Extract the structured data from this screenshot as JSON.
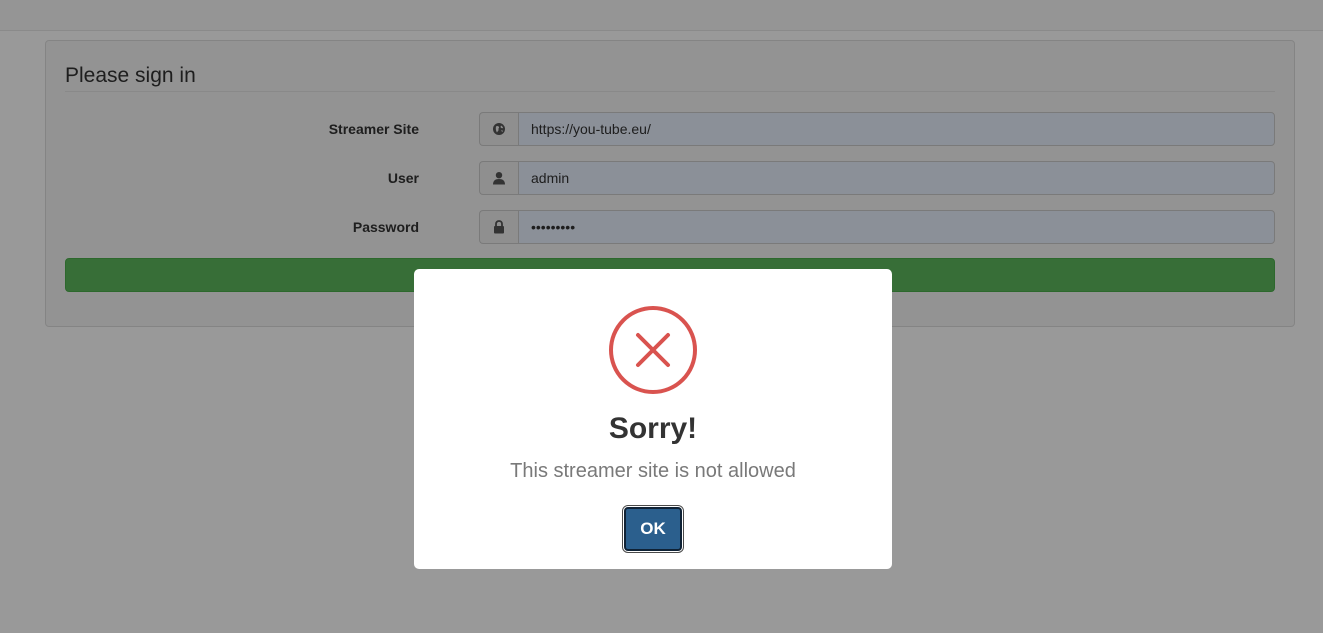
{
  "form": {
    "legend": "Please sign in",
    "fields": [
      {
        "label": "Streamer Site",
        "icon": "globe-icon",
        "value": "https://you-tube.eu/",
        "type": "text"
      },
      {
        "label": "User",
        "icon": "user-icon",
        "value": "admin",
        "type": "text"
      },
      {
        "label": "Password",
        "icon": "lock-icon",
        "value": "•••••••••",
        "type": "password"
      }
    ],
    "submit_label": "",
    "submit_color": "#5cb85c"
  },
  "modal": {
    "icon": "error-x-icon",
    "icon_color": "#d9534f",
    "title": "Sorry!",
    "message": "This streamer site is not allowed",
    "ok_label": "OK",
    "ok_color": "#2b5f8d"
  }
}
